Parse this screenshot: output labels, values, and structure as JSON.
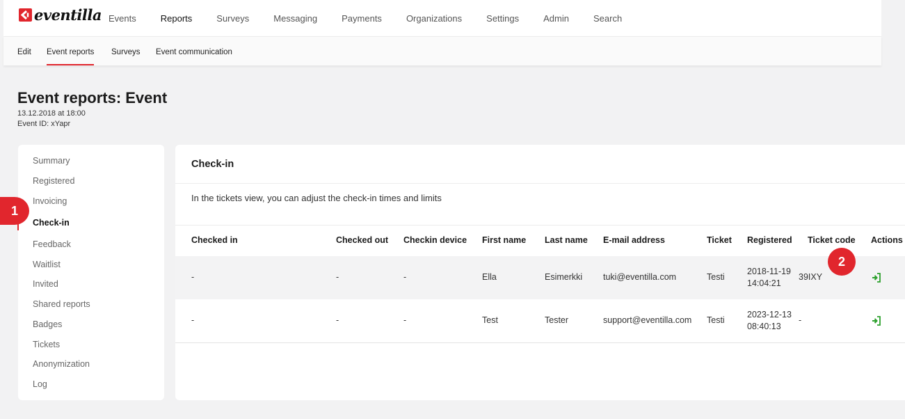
{
  "brand": {
    "name": "eventilla",
    "accent": "#e1262d"
  },
  "mainmenu": [
    "Events",
    "Reports",
    "Surveys",
    "Messaging",
    "Payments",
    "Organizations",
    "Settings",
    "Admin",
    "Search"
  ],
  "subnav": [
    "Edit",
    "Event reports",
    "Surveys",
    "Event communication"
  ],
  "header": {
    "title": "Event reports: Event",
    "date": "13.12.2018 at 18:00",
    "event_id": "Event ID: xYapr"
  },
  "sidebar": [
    "Summary",
    "Registered",
    "Invoicing",
    "Check-in",
    "Feedback",
    "Waitlist",
    "Invited",
    "Shared reports",
    "Badges",
    "Tickets",
    "Anonymization",
    "Log"
  ],
  "panel": {
    "title": "Check-in",
    "description": "In the tickets view, you can adjust the check-in times and limits"
  },
  "table": {
    "columns": [
      "Checked in",
      "Checked out",
      "Checkin device",
      "First name",
      "Last name",
      "E-mail address",
      "Ticket",
      "Registered",
      "Ticket code",
      "Actions"
    ],
    "rows": [
      {
        "checked_in": "-",
        "checked_out": "-",
        "device": "-",
        "first": "Ella",
        "last": "Esimerkki",
        "email": "tuki@eventilla.com",
        "ticket": "Testi",
        "reg_date": "2018-11-19",
        "reg_time": "14:04:21",
        "code": "39IXY",
        "action_icon": "sign-in-icon"
      },
      {
        "checked_in": "-",
        "checked_out": "-",
        "device": "-",
        "first": "Test",
        "last": "Tester",
        "email": "support@eventilla.com",
        "ticket": "Testi",
        "reg_date": "2023-12-13",
        "reg_time": "08:40:13",
        "code": "-",
        "action_icon": "sign-in-icon"
      }
    ]
  },
  "annotations": [
    "1",
    "2"
  ]
}
